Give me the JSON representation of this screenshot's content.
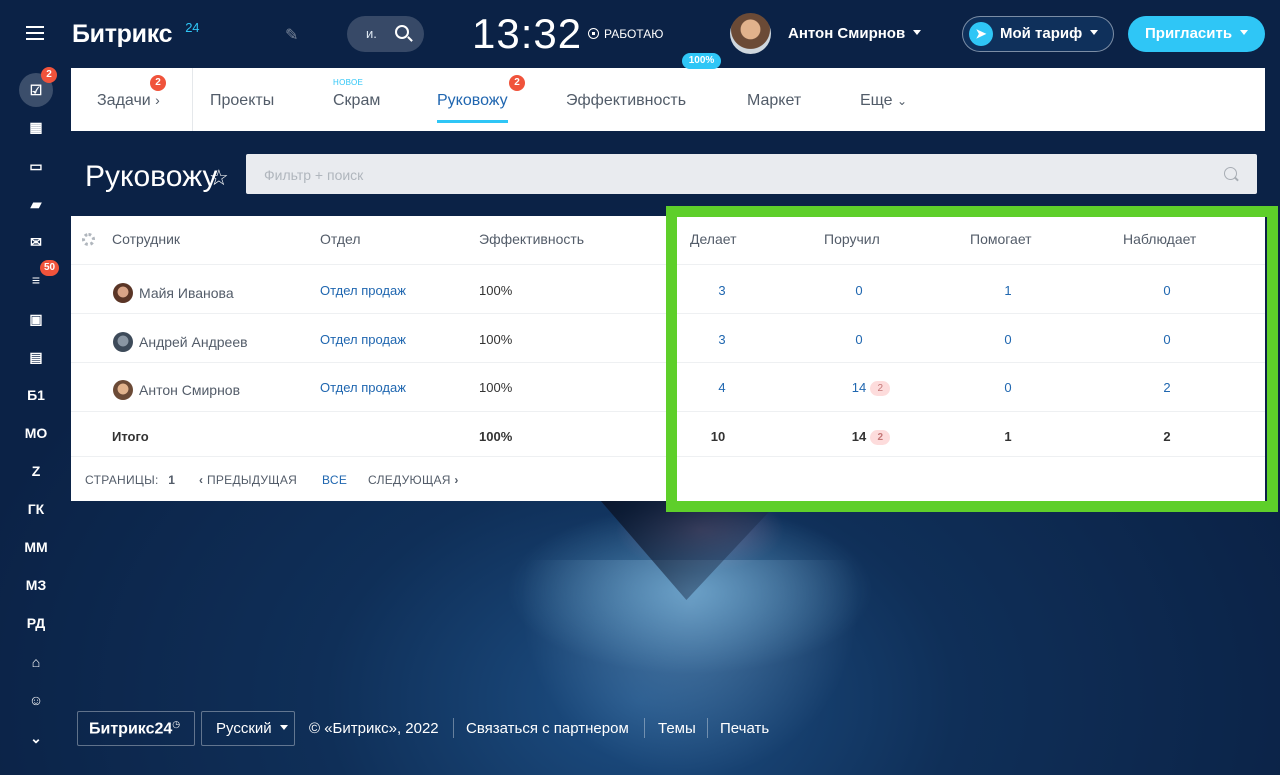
{
  "header": {
    "logo_text": "Битрикс",
    "logo_num": "24",
    "search_short": "и.",
    "clock": "13:32",
    "work_status": "РАБОТАЮ",
    "user_name": "Антон Смирнов",
    "tariff_label": "Мой тариф",
    "invite_label": "Пригласить"
  },
  "sidebar": {
    "tasks_badge": "2",
    "filter_badge": "50",
    "items": [
      "Б1",
      "МО",
      "Z",
      "ГК",
      "ММ",
      "МЗ",
      "РД"
    ]
  },
  "tabs": {
    "items": [
      {
        "label": "Задачи",
        "badge": "2"
      },
      {
        "label": "Проекты"
      },
      {
        "label": "Скрам",
        "new": "НОВОЕ"
      },
      {
        "label": "Руковожу",
        "badge": "2"
      },
      {
        "label": "Эффективность",
        "pct": "100%"
      },
      {
        "label": "Маркет"
      },
      {
        "label": "Еще"
      }
    ]
  },
  "page": {
    "title": "Руковожу",
    "filter_placeholder": "Фильтр + поиск"
  },
  "table": {
    "headers": [
      "Сотрудник",
      "Отдел",
      "Эффективность",
      "Делает",
      "Поручил",
      "Помогает",
      "Наблюдает"
    ],
    "rows": [
      {
        "name": "Майя Иванова",
        "dept": "Отдел продаж",
        "eff": "100%",
        "does": "3",
        "assigned": "0",
        "helps": "1",
        "watches": "0"
      },
      {
        "name": "Андрей Андреев",
        "dept": "Отдел продаж",
        "eff": "100%",
        "does": "3",
        "assigned": "0",
        "helps": "0",
        "watches": "0"
      },
      {
        "name": "Антон Смирнов",
        "dept": "Отдел продаж",
        "eff": "100%",
        "does": "4",
        "assigned": "14",
        "assigned_pill": "2",
        "helps": "0",
        "watches": "2"
      }
    ],
    "total": {
      "label": "Итого",
      "eff": "100%",
      "does": "10",
      "assigned": "14",
      "assigned_pill": "2",
      "helps": "1",
      "watches": "2"
    },
    "pager": {
      "pages_label": "СТРАНИЦЫ:",
      "pages_value": "1",
      "prev": "ПРЕДЫДУЩАЯ",
      "all": "ВСЕ",
      "next": "СЛЕДУЮЩАЯ"
    }
  },
  "footer": {
    "brand": "Битрикс24",
    "lang": "Русский",
    "copyright": "© «Битрикс», 2022",
    "partner": "Связаться с партнером",
    "themes": "Темы",
    "print": "Печать"
  },
  "colors": {
    "accent": "#2fc6f6",
    "highlight": "#5ecf2a",
    "badge": "#f0533b",
    "link": "#2067b0"
  }
}
